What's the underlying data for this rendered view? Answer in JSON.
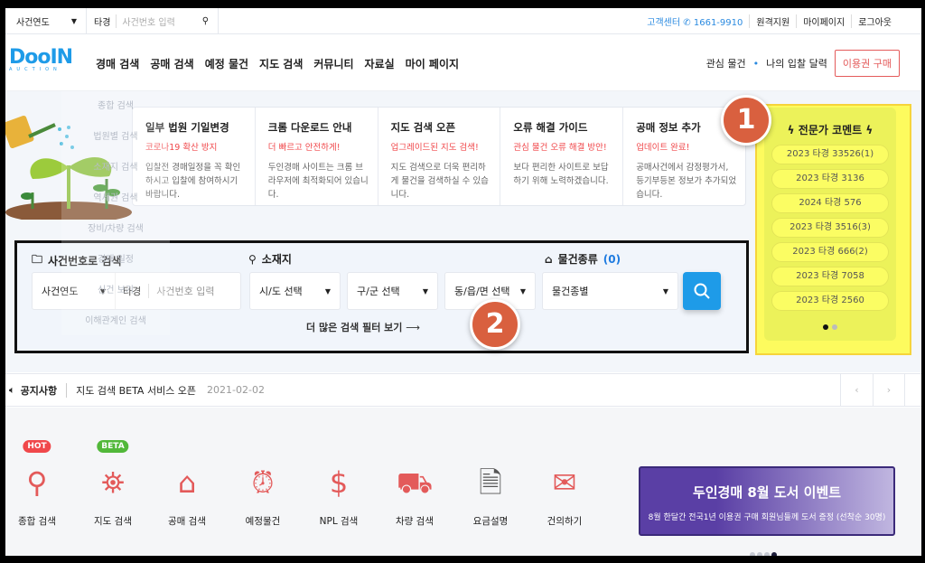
{
  "topbar": {
    "year_select": "사건연도",
    "case_type": "타경",
    "case_placeholder": "사건번호 입력",
    "customer_center": "고객센터",
    "phone": "1661-9910",
    "remote": "원격지원",
    "mypage": "마이페이지",
    "logout": "로그아웃"
  },
  "nav": {
    "logo": "DooIN",
    "logo_sub": "AUCTION",
    "menu": [
      "경매 검색",
      "공매 검색",
      "예정 물건",
      "지도 검색",
      "커뮤니티",
      "자료실",
      "마이 페이지"
    ],
    "interest": "관심 물건",
    "bid": "나의 입찰 달력",
    "buy": "이용권 구매"
  },
  "ghost_menu": [
    "종합 검색",
    "법원별 검색",
    "소재지 검색",
    "역세권 검색",
    "장비/차량 검색",
    "경매 일정",
    "신건 보기",
    "이해관계인 검색"
  ],
  "cards": [
    {
      "title": "일부 법원 기일변경",
      "sub": "코로나19 확산 방지",
      "body": "입찰전 경매일정을 꼭 확인하시고 입찰에 참여하시기 바랍니다."
    },
    {
      "title": "크롬 다운로드 안내",
      "sub": "더 빠르고 안전하게!",
      "body": "두인경매 사이트는 크롬 브라우저에 최적화되어 있습니다."
    },
    {
      "title": "지도 검색 오픈",
      "sub": "업그레이드된 지도 검색!",
      "body": "지도 검색으로 더욱 편리하게 물건을 검색하실 수 있습니다."
    },
    {
      "title": "오류 해결 가이드",
      "sub": "관심 물건 오류 해결 방안!",
      "body": "보다 편리한 사이트로 보답하기 위해 노력하겠습니다."
    },
    {
      "title": "공매 정보 추가",
      "sub": "업데이트 완료!",
      "body": "공매사건에서 감정평가서, 등기부등본 정보가 추가되었습니다."
    }
  ],
  "search": {
    "case_label": "사건번호로 검색",
    "year": "사건연도",
    "case_type": "타경",
    "case_placeholder": "사건번호 입력",
    "loc_label": "소재지",
    "sido": "시/도 선택",
    "gugun": "구/군 선택",
    "dong": "동/읍/면 선택",
    "type_label": "물건종류",
    "type_count": "(0)",
    "type_select": "물건종별",
    "more": "더 많은 검색 필터 보기"
  },
  "expert": {
    "title": "전문가 코멘트",
    "items": [
      "2023 타경 33526(1)",
      "2023 타경 3136",
      "2024 타경 576",
      "2023 타경 3516(3)",
      "2023 타경 666(2)",
      "2023 타경 7058",
      "2023 타경 2560"
    ],
    "page": 1,
    "pages": 2
  },
  "annotations": [
    "1",
    "2"
  ],
  "notice": {
    "label": "공지사항",
    "text": "지도 검색 BETA 서비스 오픈",
    "date": "2021-02-02"
  },
  "quick": [
    {
      "label": "종합 검색",
      "badge": "HOT",
      "icon": "search-all-icon"
    },
    {
      "label": "지도 검색",
      "badge": "BETA",
      "icon": "map-pin-icon"
    },
    {
      "label": "공매 검색",
      "icon": "house-hand-icon"
    },
    {
      "label": "예정물건",
      "icon": "alarm-clock-icon"
    },
    {
      "label": "NPL 검색",
      "icon": "money-hand-icon"
    },
    {
      "label": "차량 검색",
      "icon": "car-icon"
    },
    {
      "label": "요금설명",
      "icon": "document-icon"
    },
    {
      "label": "건의하기",
      "icon": "mail-icon"
    }
  ],
  "banner": {
    "title": "두인경매 8월 도서 이벤트",
    "sub": "8월 한달간 전국1년 이용권 구매 회원님들께 도서 증정 (선착순 30명)",
    "page": 4,
    "pages": 4
  },
  "colors": {
    "accent": "#1e9be8",
    "red": "#f0484b",
    "highlight": "#fdfb5e",
    "annotation": "#d9603f"
  }
}
